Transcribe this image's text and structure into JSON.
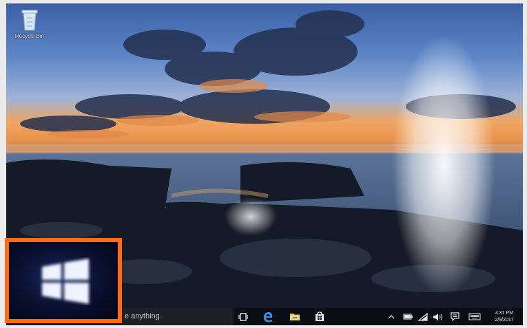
{
  "desktop": {
    "recycle_bin_label": "Recycle Bin"
  },
  "taskbar": {
    "search_text": "e anything.",
    "pinned": [
      "task-view-icon",
      "edge-icon",
      "file-explorer-icon",
      "store-icon"
    ],
    "tray": [
      "chevron-up-icon",
      "battery-icon",
      "wifi-icon",
      "volume-icon",
      "action-center-icon",
      "keyboard-icon"
    ],
    "clock_time": "4:31 PM",
    "clock_date": "2/9/2017"
  },
  "colors": {
    "callout_border": "#ff6a13",
    "taskbar_bg": "#0a0d14",
    "edge_blue": "#3c8fe6"
  }
}
